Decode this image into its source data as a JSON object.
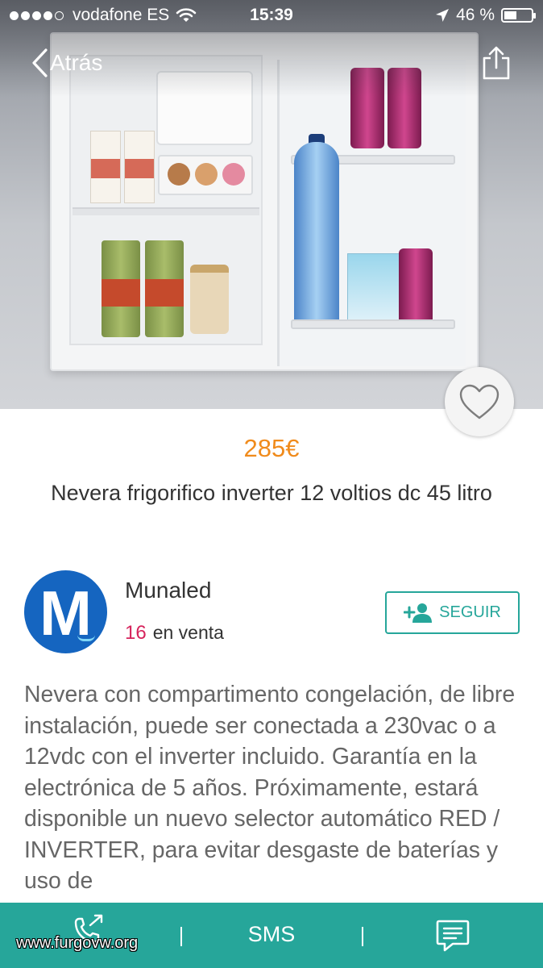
{
  "status_bar": {
    "carrier": "vodafone ES",
    "time": "15:39",
    "battery_percent": "46 %",
    "battery_level": 0.46,
    "signal_bars_filled": 4,
    "signal_bars_total": 5
  },
  "nav": {
    "back_label": "Atrás"
  },
  "product": {
    "price": "285€",
    "title": "Nevera frigorifico inverter 12 voltios dc 45 litro",
    "favorited": false
  },
  "seller": {
    "avatar_letter": "M",
    "name": "Munaled",
    "items_count": "16",
    "items_label": "en venta",
    "follow_label": "SEGUIR"
  },
  "description": "Nevera con compartimento congelación, de libre instalación, puede ser conectada a 230vac o a 12vdc con el inverter incluido. Garantía en la electrónica de 5 años. Próximamente, estará disponible un nuevo selector automático RED / INVERTER, para evitar desgaste de baterías y uso de",
  "bottom_bar": {
    "sms_label": "SMS"
  },
  "watermark": "www.furgovw.org",
  "colors": {
    "accent": "#26a69a",
    "price": "#f08b1c",
    "count": "#d6245c",
    "avatar_bg": "#1565c0"
  },
  "icons": {
    "back": "chevron-left-icon",
    "share": "share-icon",
    "favorite": "heart-outline-icon",
    "follow": "add-user-icon",
    "call": "phone-icon",
    "chat": "chat-icon",
    "wifi": "wifi-icon",
    "location": "location-arrow-icon",
    "battery": "battery-icon"
  }
}
